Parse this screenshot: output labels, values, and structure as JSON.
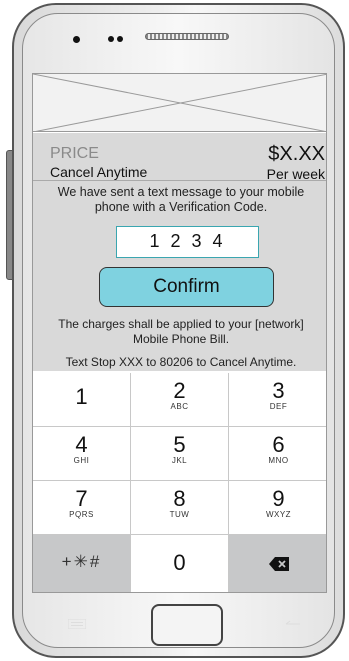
{
  "pricing": {
    "price_label": "PRICE",
    "cancel_label": "Cancel Anytime",
    "price_value": "$X.XX",
    "period": "Per week"
  },
  "verification": {
    "message": "We have sent a text message to your mobile phone with a Verification Code.",
    "code_value": "1 2 3 4"
  },
  "confirm_label": "Confirm",
  "legal": {
    "charges": "The charges shall be applied to your [network] Mobile Phone Bill.",
    "stop": "Text Stop XXX to 80206 to Cancel Anytime."
  },
  "keypad": {
    "keys": [
      {
        "num": "1",
        "letters": ""
      },
      {
        "num": "2",
        "letters": "ABC"
      },
      {
        "num": "3",
        "letters": "DEF"
      },
      {
        "num": "4",
        "letters": "GHI"
      },
      {
        "num": "5",
        "letters": "JKL"
      },
      {
        "num": "6",
        "letters": "MNO"
      },
      {
        "num": "7",
        "letters": "PQRS"
      },
      {
        "num": "8",
        "letters": "TUW"
      },
      {
        "num": "9",
        "letters": "WXYZ"
      },
      {
        "num": "0",
        "letters": ""
      }
    ],
    "symbols": "+✳#",
    "delete_icon": "backspace-icon"
  },
  "colors": {
    "confirm_bg": "#7fd2e0",
    "content_bg": "#d9d9d9",
    "code_border": "#3aa6b0",
    "symbol_key_bg": "#c7c8c9"
  }
}
